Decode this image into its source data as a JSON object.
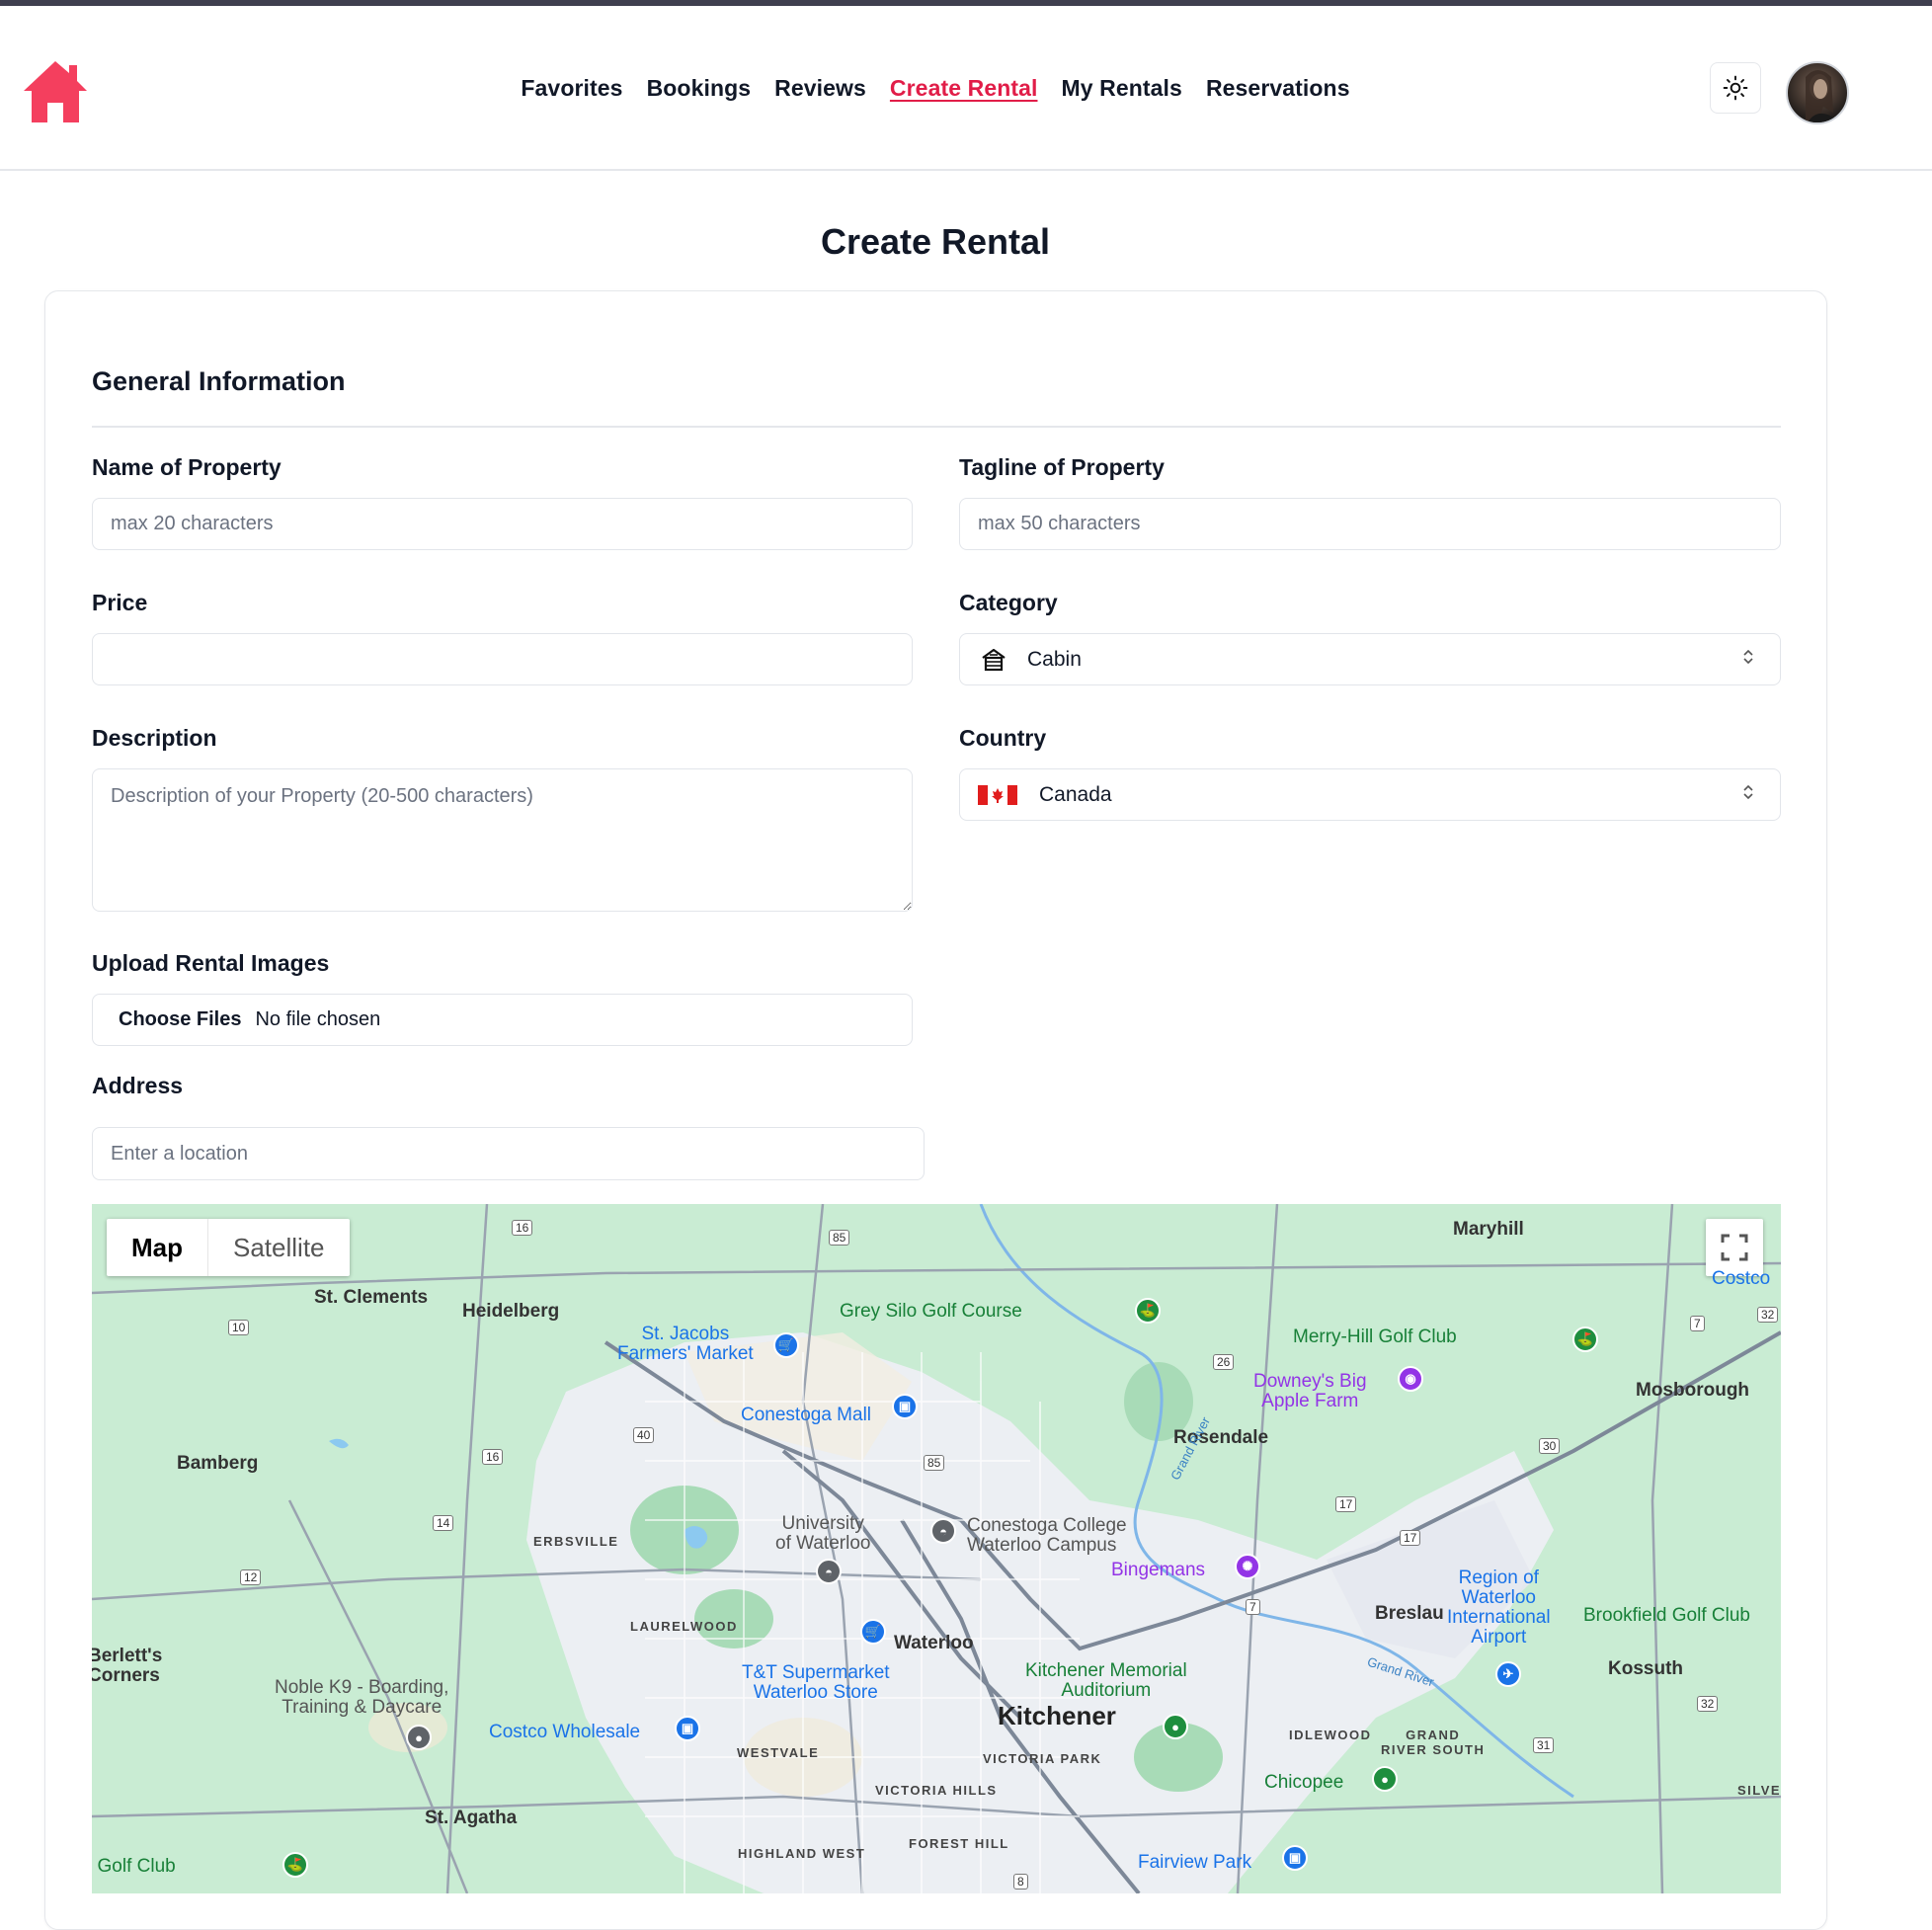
{
  "nav": {
    "links": [
      "Favorites",
      "Bookings",
      "Reviews",
      "Create Rental",
      "My Rentals",
      "Reservations"
    ],
    "active": "Create Rental"
  },
  "page": {
    "title": "Create Rental"
  },
  "form": {
    "section_title": "General Information",
    "name": {
      "label": "Name of Property",
      "placeholder": "max 20 characters",
      "value": ""
    },
    "tagline": {
      "label": "Tagline of Property",
      "placeholder": "max 50 characters",
      "value": ""
    },
    "price": {
      "label": "Price",
      "value": ""
    },
    "category": {
      "label": "Category",
      "selected": "Cabin",
      "icon": "cabin-icon"
    },
    "description": {
      "label": "Description",
      "placeholder": "Description of your Property (20-500 characters)"
    },
    "country": {
      "label": "Country",
      "selected": "Canada",
      "flag": "canada-flag"
    },
    "images": {
      "label": "Upload Rental Images",
      "button": "Choose Files",
      "status": "No file chosen"
    },
    "address": {
      "label": "Address",
      "placeholder": "Enter a location"
    }
  },
  "map": {
    "type_buttons": [
      "Map",
      "Satellite"
    ],
    "selected_type": "Map",
    "places": {
      "st_clements": "St. Clements",
      "heidelberg": "Heidelberg",
      "maryhill": "Maryhill",
      "costco_top": "Costco",
      "grey_silo": "Grey Silo Golf Course",
      "st_jacobs": "St. Jacobs\nFarmers' Market",
      "merry_hill": "Merry-Hill Golf Club",
      "downey": "Downey's Big\nApple Farm",
      "mosborough": "Mosborough",
      "conestoga_mall": "Conestoga Mall",
      "rosendale": "Rosendale",
      "bamberg": "Bamberg",
      "university": "University\nof Waterloo",
      "conestoga_college": "Conestoga College\nWaterloo Campus",
      "erbsville": "ERBSVILLE",
      "bingemans": "Bingemans",
      "region_airport": "Region of\nWaterloo\nInternational\nAirport",
      "breslau": "Breslau",
      "brookfield": "Brookfield Golf Club",
      "laurelwood": "LAURELWOOD",
      "waterloo": "Waterloo",
      "berletts": "Berlett's\nCorners",
      "noble_k9": "Noble K9 - Boarding,\nTraining & Daycare",
      "tt": "T&T Supermarket\nWaterloo Store",
      "kmac": "Kitchener Memorial\nAuditorium",
      "kossuth": "Kossuth",
      "kitchener": "Kitchener",
      "grand_river_1": "Grand River",
      "grand_river_2": "Grand River",
      "costco_wholesale": "Costco Wholesale",
      "westvale": "WESTVALE",
      "victoria_park": "VICTORIA PARK",
      "idlewood": "IDLEWOOD",
      "grand_river_south": "GRAND\nRIVER SOUTH",
      "victoria_hills": "VICTORIA HILLS",
      "chicopee": "Chicopee",
      "silve": "SILVE",
      "st_agatha": "St. Agatha",
      "golf_club": "l Golf Club",
      "highland_west": "HIGHLAND WEST",
      "forest_hill": "FOREST HILL",
      "fairview": "Fairview Park"
    },
    "road_shields": [
      "16",
      "85",
      "10",
      "26",
      "7",
      "32",
      "40",
      "16",
      "85",
      "30",
      "14",
      "17",
      "17",
      "12",
      "7",
      "32",
      "31",
      "8"
    ]
  },
  "colors": {
    "accent": "#e11d48",
    "logo": "#f43f5e",
    "map_green": "#c9ecd3",
    "map_urban": "#eceff3"
  }
}
